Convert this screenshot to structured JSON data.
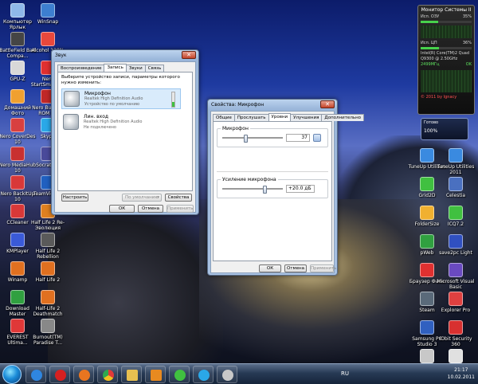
{
  "desktop": {
    "icons_left": [
      {
        "label": "Компьютер Ярлык",
        "color": "#8fb8e8"
      },
      {
        "label": "WinSnap",
        "color": "#3d7fd0"
      },
      {
        "label": "BattleField Bad Compa...",
        "color": "#454545"
      },
      {
        "label": "Alcohol 120%",
        "color": "#e8483c"
      },
      {
        "label": "GPU-Z",
        "color": "#d8d8d8"
      },
      {
        "label": "Nero StartSmart 10",
        "color": "#e03030"
      },
      {
        "label": "Домашний Фото",
        "color": "#f0a030"
      },
      {
        "label": "Nero Burning ROM 10",
        "color": "#c02828"
      },
      {
        "label": "Nero CoverDes 10",
        "color": "#d84040"
      },
      {
        "label": "Skype",
        "color": "#2aa8e8"
      },
      {
        "label": "Nero MediaHub 10",
        "color": "#c83030"
      },
      {
        "label": "Socratesx",
        "color": "#4a4a9a"
      },
      {
        "label": "Nero BackItUp 10",
        "color": "#d83838"
      },
      {
        "label": "TeamViewer",
        "color": "#2060c0"
      },
      {
        "label": "CCleaner",
        "color": "#d83838"
      },
      {
        "label": "Half Life 2 Re-Эволюция",
        "color": "#e08020"
      },
      {
        "label": "KMPlayer",
        "color": "#3a5ad8"
      },
      {
        "label": "Half Life 2 Rebellion",
        "color": "#5a5a5a"
      },
      {
        "label": "Winamp",
        "color": "#e07020"
      },
      {
        "label": "Half Life 2",
        "color": "#e07020"
      },
      {
        "label": "Download Master",
        "color": "#30a040"
      },
      {
        "label": "Half-Life 2 Deathmatch",
        "color": "#e07020"
      },
      {
        "label": "EVEREST Ultima...",
        "color": "#e03838"
      },
      {
        "label": "Burnout(TM) Paradise T...",
        "color": "#888"
      }
    ],
    "icons_right": [
      {
        "label": "TuneUp Utilities",
        "color": "#3a8ae0"
      },
      {
        "label": "TuneUp Utilities 2011",
        "color": "#3a8ae0"
      },
      {
        "label": "Grid2D",
        "color": "#40c040"
      },
      {
        "label": "Celestia",
        "color": "#4a70c0"
      },
      {
        "label": "FolderSize",
        "color": "#f0b030"
      },
      {
        "label": "ICQ7.2",
        "color": "#40c040"
      },
      {
        "label": "pWeb",
        "color": "#30a040"
      },
      {
        "label": "save2pc Light",
        "color": "#3050c0"
      },
      {
        "label": "Браузер Фаон",
        "color": "#e03030"
      },
      {
        "label": "Microsoft Visual Basic",
        "color": "#6a4ac0"
      },
      {
        "label": "Steam",
        "color": "#5a6a7a"
      },
      {
        "label": "Explorer Pro",
        "color": "#e04040"
      },
      {
        "label": "Samsung PC Studio 3",
        "color": "#3060c0"
      },
      {
        "label": "IObit Security 360",
        "color": "#d83030"
      },
      {
        "label": "EA Download Manager",
        "color": "#c8c8c8"
      },
      {
        "label": "Google Пикасо",
        "color": "#e0e0e0"
      },
      {
        "label": "Корзина",
        "color": "#b0c8e0"
      }
    ]
  },
  "taskbar": {
    "language": "RU",
    "time": "21:17",
    "date": "10.02.2011"
  },
  "gadget_monitor": {
    "title": "Монитор Системы II",
    "ram_label": "Исп. ОЗУ",
    "ram_value": "35%",
    "cpu_label": "Исп. ЦП",
    "cpu_value": "36%",
    "cpu_name": "Intel(R) Core(TM)2 Quad",
    "cpu_freq": "Q9300 @ 2.50GHz",
    "mhz_value": "2499МГц",
    "ok_label": "OK",
    "footer": "© 2011 by Ignacy"
  },
  "gadget_volume": {
    "title": "Готово",
    "value": "100%"
  },
  "sound_window": {
    "title": "Звук",
    "tabs": [
      "Воспроизведение",
      "Запись",
      "Звуки",
      "Связь"
    ],
    "active_tab": 1,
    "instruction": "Выберите устройство записи, параметры которого нужно изменить:",
    "devices": [
      {
        "name": "Микрофон",
        "driver": "Realtek High Definition Audio",
        "status": "Устройство по умолчанию",
        "level": 35
      },
      {
        "name": "Лин. вход",
        "driver": "Realtek High Definition Audio",
        "status": "Не подключено"
      }
    ],
    "configure_button": "Настроить",
    "default_button": "По умолчанию",
    "properties_button": "Свойства",
    "ok": "ОК",
    "cancel": "Отмена",
    "apply": "Применить"
  },
  "mic_window": {
    "title": "Свойства: Микрофон",
    "tabs": [
      "Общие",
      "Прослушать",
      "Уровни",
      "Улучшения",
      "Дополнительно"
    ],
    "active_tab": 2,
    "mic_group": "Микрофон",
    "mic_value": "37",
    "boost_group": "Усиление микрофона",
    "boost_value": "+20.0 дБ",
    "ok": "ОК",
    "cancel": "Отмена",
    "apply": "Применить"
  }
}
